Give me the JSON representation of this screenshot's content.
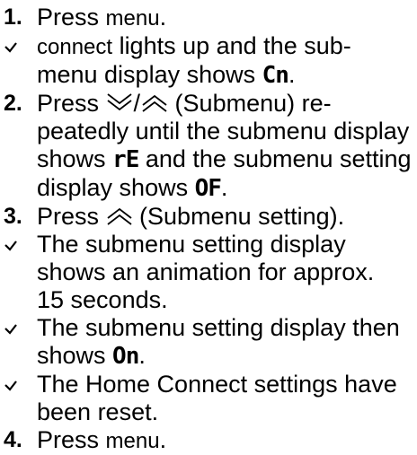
{
  "steps": [
    {
      "type": "numbered",
      "number": "1.",
      "parts": {
        "a": "Press ",
        "key": "menu",
        "b": "."
      }
    },
    {
      "type": "result",
      "parts": {
        "a": "connect",
        "b": " lights up and the sub-",
        "c": "menu display shows ",
        "seg": "Cn",
        "d": "."
      }
    },
    {
      "type": "numbered",
      "number": "2.",
      "parts": {
        "a": "Press ",
        "sep": "/",
        "b": " (Submenu) re-",
        "c": "peatedly until the submenu display",
        "d": "shows ",
        "seg1": "rE",
        "e": " and the submenu setting",
        "f": "display shows ",
        "seg2": "OF",
        "g": "."
      }
    },
    {
      "type": "numbered",
      "number": "3.",
      "parts": {
        "a": "Press ",
        "b": " (Submenu setting)."
      }
    },
    {
      "type": "result",
      "parts": {
        "a": "The submenu setting display",
        "b": "shows an animation for approx.",
        "c": "15 seconds."
      }
    },
    {
      "type": "result",
      "parts": {
        "a": "The submenu setting display then",
        "b": "shows ",
        "seg": "On",
        "c": "."
      }
    },
    {
      "type": "result",
      "parts": {
        "a": "The Home Connect settings have",
        "b": "been reset."
      }
    },
    {
      "type": "numbered",
      "number": "4.",
      "parts": {
        "a": "Press ",
        "key": "menu",
        "b": "."
      }
    }
  ],
  "icons": {
    "result_marker": "checkmark-icon",
    "down_arrow": "double-chevron-down-icon",
    "up_arrow": "double-chevron-up-icon"
  }
}
